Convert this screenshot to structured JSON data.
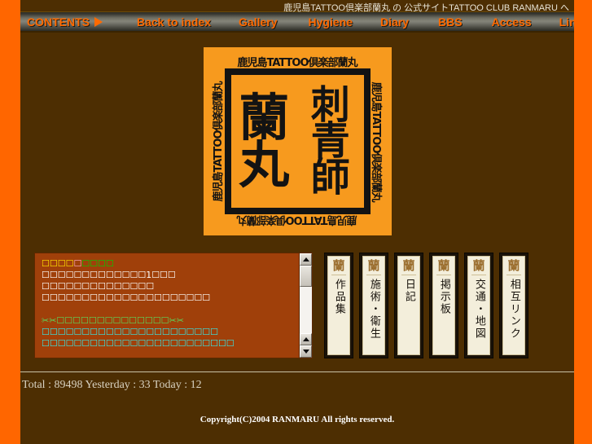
{
  "header": {
    "site_title": "鹿児島TATTOO倶楽部蘭丸 の 公式サイトTATTOO CLUB RANMARU へ"
  },
  "nav": {
    "items": [
      {
        "label": "CONTENTS",
        "icon": "play-triangle-icon"
      },
      {
        "label": "Back to index",
        "icon": ""
      },
      {
        "label": "Gallery",
        "icon": ""
      },
      {
        "label": "Hygiene",
        "icon": ""
      },
      {
        "label": "Diary",
        "icon": ""
      },
      {
        "label": "BBS",
        "icon": ""
      },
      {
        "label": "Access",
        "icon": ""
      },
      {
        "label": "Link",
        "icon": ""
      }
    ]
  },
  "logo": {
    "edge_text": "鹿児島TATTOO倶楽部蘭丸",
    "center_right": "刺青師",
    "center_left": "蘭丸"
  },
  "notice": {
    "lines": [
      {
        "text": "☐☐☐☐☐☐☐☐☐",
        "color": "mixed-yellow-pink-green"
      },
      {
        "text": "☐☐☐☐☐☐☐☐☐☐☐☐☐1☐☐☐",
        "color": "white"
      },
      {
        "text": "☐☐☐☐☐☐☐☐☐☐☐☐☐☐",
        "color": "white"
      },
      {
        "text": "☐☐☐☐☐☐☐☐☐☐☐☐☐☐☐☐☐☐☐☐☐",
        "color": "white"
      },
      {
        "text": "",
        "color": "none"
      },
      {
        "text": "✂✂☐☐☐☐☐☐☐☐☐☐☐☐☐☐✂✂",
        "color": "green"
      },
      {
        "text": "☐☐☐☐☐☐☐☐☐☐☐☐☐☐☐☐☐☐☐☐☐☐",
        "color": "cyan"
      },
      {
        "text": "☐☐☐☐☐☐☐☐☐☐☐☐☐☐☐☐☐☐☐☐☐☐☐☐",
        "color": "cyan"
      }
    ],
    "line1_segments": [
      {
        "text": "☐☐☐☐",
        "color": "yellow"
      },
      {
        "text": "☐",
        "color": "pink"
      },
      {
        "text": "☐☐☐☐",
        "color": "green"
      }
    ],
    "line6_segments": [
      {
        "text": "✂✂",
        "color": "green"
      },
      {
        "text": "☐☐☐☐☐☐☐☐☐☐☐☐☐☐",
        "color": "green"
      },
      {
        "text": "✂✂",
        "color": "green"
      }
    ],
    "scrollbar": {
      "up_arrow": "▲",
      "down_arrow": "▼"
    }
  },
  "tiles": [
    {
      "head": "蘭",
      "label": "作品集"
    },
    {
      "head": "蘭",
      "label": "施術・衛生"
    },
    {
      "head": "蘭",
      "label": "日記"
    },
    {
      "head": "蘭",
      "label": "掲示板"
    },
    {
      "head": "蘭",
      "label": "交通・地図"
    },
    {
      "head": "蘭",
      "label": "相互リンク"
    }
  ],
  "footer": {
    "counter": "Total : 89498 Yesterday : 33 Today : 12",
    "copyright": "Copyright(C)2004 RANMARU All rights reserved."
  },
  "colors": {
    "page_bg": "#4d2e02",
    "rail": "#ff6600",
    "accent_orange": "#ff6a00",
    "logo_bg": "#f79a1e",
    "panel_bg": "#a0400a",
    "tile_bg": "#f3eedb"
  }
}
